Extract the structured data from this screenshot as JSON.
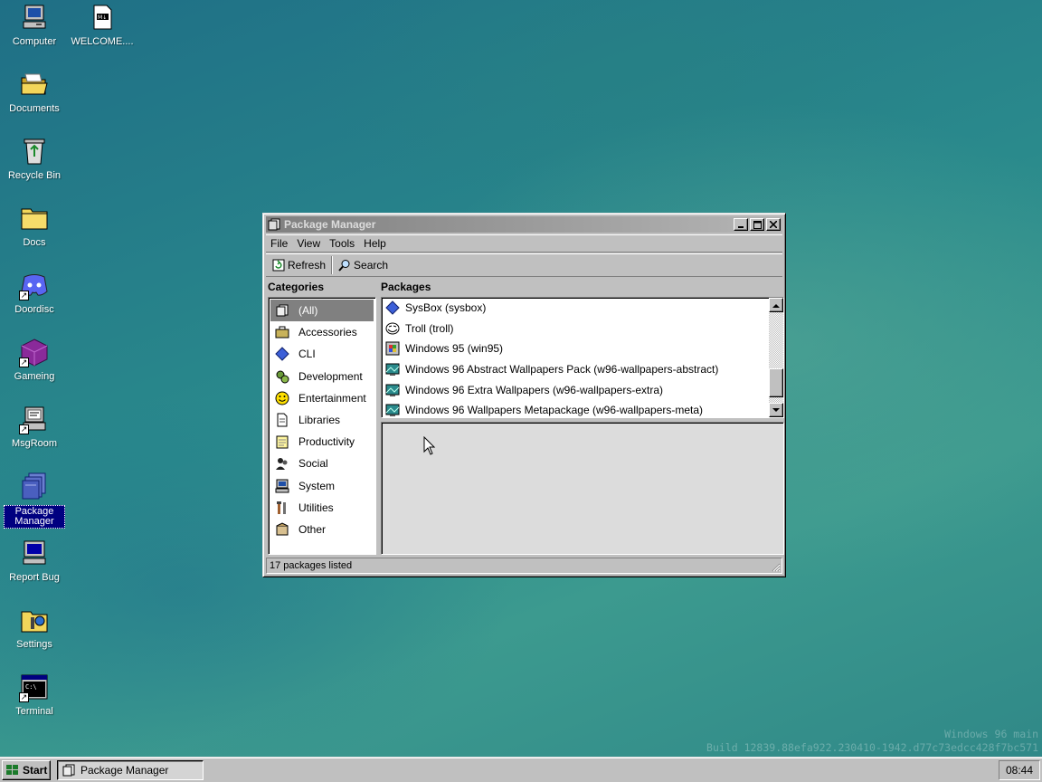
{
  "desktop": {
    "icons": [
      {
        "label": "Computer",
        "icon": "computer-icon"
      },
      {
        "label": "WELCOME....",
        "icon": "markdown-file-icon"
      },
      {
        "label": "Documents",
        "icon": "folder-open-icon"
      },
      {
        "label": "Recycle Bin",
        "icon": "recycle-bin-icon"
      },
      {
        "label": "Docs",
        "icon": "folder-icon"
      },
      {
        "label": "Doordisc",
        "icon": "discord-icon"
      },
      {
        "label": "Gameing",
        "icon": "cube-icon"
      },
      {
        "label": "MsgRoom",
        "icon": "chat-icon"
      },
      {
        "label": "Package Manager",
        "icon": "package-icon"
      },
      {
        "label": "Report Bug",
        "icon": "monitor-bug-icon"
      },
      {
        "label": "Settings",
        "icon": "settings-icon"
      },
      {
        "label": "Terminal",
        "icon": "terminal-icon"
      }
    ],
    "watermark": {
      "line1": "Windows 96 main",
      "line2": "Build 12839.88efa922.230410-1942.d77c73edcc428f7bc571"
    }
  },
  "window": {
    "title": "Package Manager",
    "menu": [
      "File",
      "View",
      "Tools",
      "Help"
    ],
    "toolbar": {
      "refresh_label": "Refresh",
      "search_label": "Search"
    },
    "categories_title": "Categories",
    "packages_title": "Packages",
    "categories": [
      {
        "label": "(All)",
        "icon": "all-icon",
        "selected": true
      },
      {
        "label": "Accessories",
        "icon": "briefcase-icon"
      },
      {
        "label": "CLI",
        "icon": "diamond-icon"
      },
      {
        "label": "Development",
        "icon": "gears-icon"
      },
      {
        "label": "Entertainment",
        "icon": "smiley-icon"
      },
      {
        "label": "Libraries",
        "icon": "document-icon"
      },
      {
        "label": "Productivity",
        "icon": "notepad-icon"
      },
      {
        "label": "Social",
        "icon": "people-icon"
      },
      {
        "label": "System",
        "icon": "system-icon"
      },
      {
        "label": "Utilities",
        "icon": "tools-icon"
      },
      {
        "label": "Other",
        "icon": "misc-icon"
      }
    ],
    "packages": [
      {
        "label": "SysBox (sysbox)",
        "icon": "diamond-icon"
      },
      {
        "label": "Troll (troll)",
        "icon": "troll-face-icon"
      },
      {
        "label": "Windows 95 (win95)",
        "icon": "windows-icon"
      },
      {
        "label": "Windows 96 Abstract Wallpapers Pack (w96-wallpapers-abstract)",
        "icon": "wallpaper-icon"
      },
      {
        "label": "Windows 96 Extra Wallpapers (w96-wallpapers-extra)",
        "icon": "wallpaper-icon"
      },
      {
        "label": "Windows 96 Wallpapers Metapackage (w96-wallpapers-meta)",
        "icon": "wallpaper-icon"
      }
    ],
    "status": "17 packages listed"
  },
  "taskbar": {
    "start_label": "Start",
    "task_label": "Package Manager",
    "clock": "08:44"
  },
  "colors": {
    "selection": "#000080",
    "window_face": "#c0c0c0",
    "title_inactive": "#808080"
  }
}
